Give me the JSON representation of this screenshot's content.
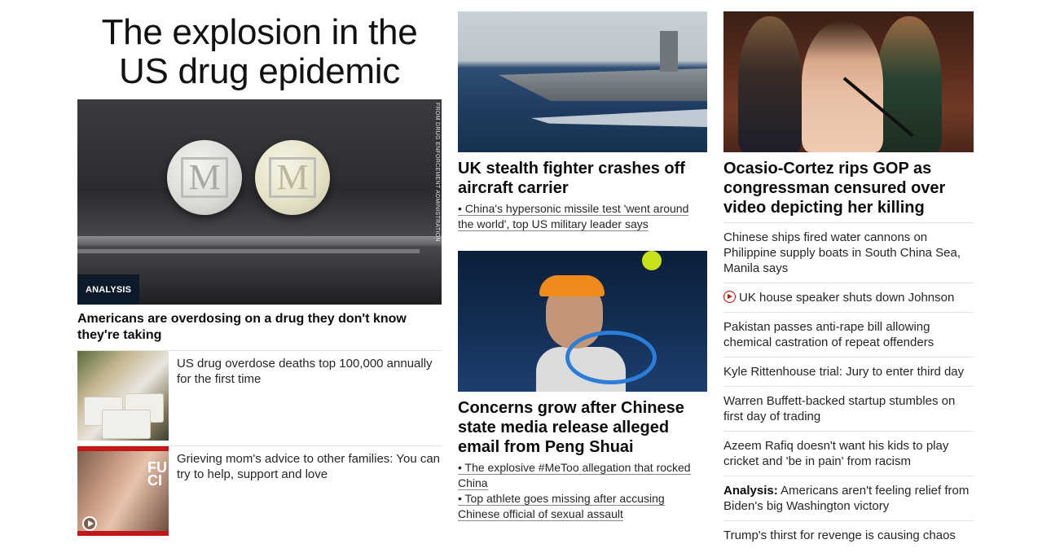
{
  "left": {
    "title": "The explosion in the US drug epidemic",
    "hero": {
      "image_credit": "FROM DRUG ENFORCEMENT ADMINISTRATION",
      "badge": "ANALYSIS",
      "headline": "Americans are overdosing on a drug they don't know they're taking"
    },
    "items": [
      {
        "text": "US drug overdose deaths top 100,000 annually for the first time",
        "has_video": false
      },
      {
        "text": "Grieving mom's advice to other families: You can try to help, support and love",
        "has_video": true,
        "thumb_overlay": "FU\nCI"
      }
    ]
  },
  "middle": {
    "story1": {
      "headline": "UK stealth fighter crashes off aircraft carrier",
      "links": [
        "• China's hypersonic missile test 'went around the world', top US military leader says"
      ]
    },
    "story2": {
      "headline": "Concerns grow after Chinese state media release alleged email from Peng Shuai",
      "links": [
        "• The explosive #MeToo allegation that rocked China",
        "• Top athlete goes missing after accusing Chinese official of sexual assault"
      ]
    }
  },
  "right": {
    "headline": "Ocasio-Cortez rips GOP as congressman censured over video depicting her killing",
    "list": [
      {
        "text": "Chinese ships fired water cannons on Philippine supply boats in South China Sea, Manila says"
      },
      {
        "text": "UK house speaker shuts down Johnson",
        "icon": "video-play-icon"
      },
      {
        "text": "Pakistan passes anti-rape bill allowing chemical castration of repeat offenders"
      },
      {
        "text": "Kyle Rittenhouse trial: Jury to enter third day"
      },
      {
        "text": "Warren Buffett-backed startup stumbles on first day of trading"
      },
      {
        "text": "Azeem Rafiq doesn't want his kids to play cricket and 'be in pain' from racism"
      },
      {
        "label": "Analysis:",
        "text": " Americans aren't feeling relief from Biden's big Washington victory"
      },
      {
        "text": "Trump's thirst for revenge is causing chaos"
      }
    ]
  },
  "colors": {
    "accent_red": "#cc0000",
    "badge_bg": "#0c1a2a",
    "divider": "#e3e3e3"
  }
}
